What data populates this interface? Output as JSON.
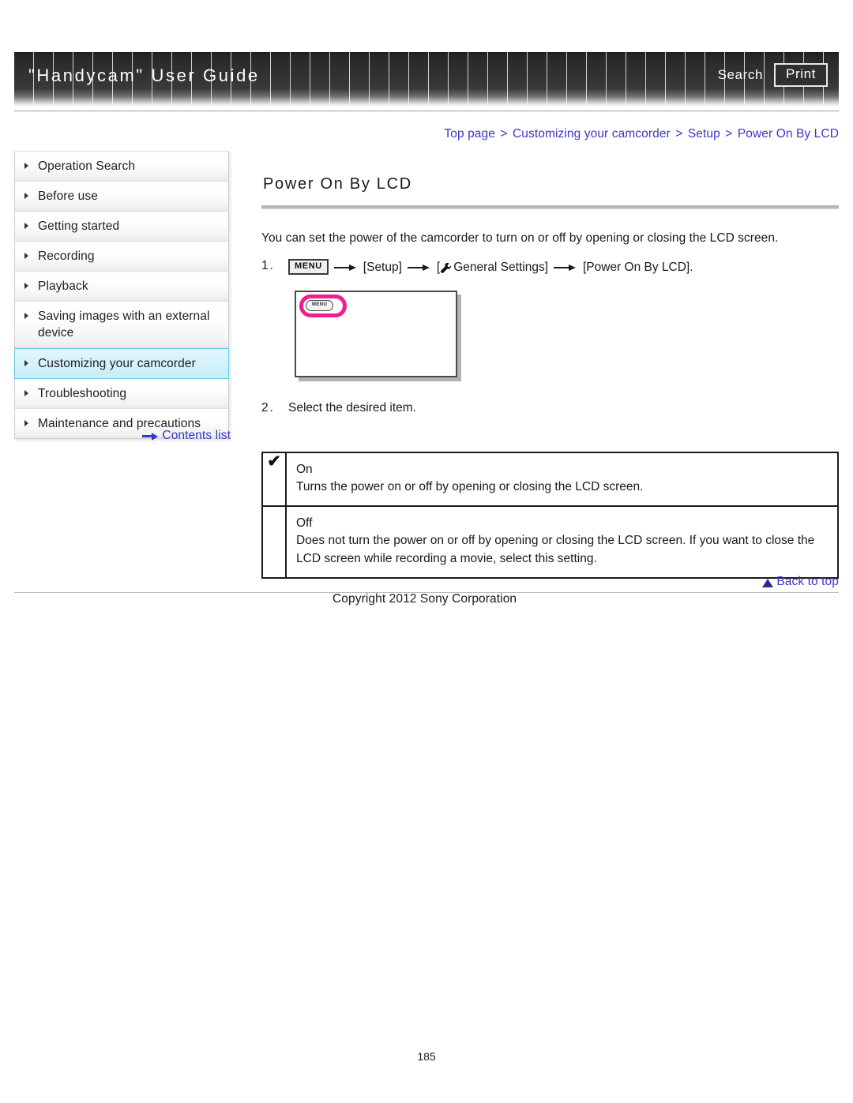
{
  "header": {
    "title": "\"Handycam\" User Guide",
    "search_label": "Search",
    "print_label": "Print"
  },
  "breadcrumb": {
    "items": [
      "Top page",
      "Customizing your camcorder",
      "Setup",
      "Power On By LCD"
    ],
    "separator": ">",
    "color": "#3b37c8"
  },
  "sidebar": {
    "items": [
      {
        "label": "Operation Search",
        "selected": false
      },
      {
        "label": "Before use",
        "selected": false
      },
      {
        "label": "Getting started",
        "selected": false
      },
      {
        "label": "Recording",
        "selected": false
      },
      {
        "label": "Playback",
        "selected": false
      },
      {
        "label": "Saving images with an external device",
        "selected": false
      },
      {
        "label": "Customizing your camcorder",
        "selected": true
      },
      {
        "label": "Troubleshooting",
        "selected": false
      },
      {
        "label": "Maintenance and precautions",
        "selected": false
      }
    ],
    "contents_list_label": "Contents list",
    "selected_border_color": "#66c8e2"
  },
  "main": {
    "title": "Power On By LCD",
    "intro": "You can set the power of the camcorder to turn on or off by opening or closing the LCD screen.",
    "step1": {
      "number": "1.",
      "menu_chip": "MENU",
      "part_setup": "[Setup]",
      "part_general_open": "[",
      "part_general": "General Settings]",
      "part_target": "[Power On By LCD]."
    },
    "screenshot": {
      "menu_chip": "MENU",
      "highlight_color": "#ee1f8e"
    },
    "step2": {
      "number": "2.",
      "text": "Select the desired item."
    },
    "options": [
      {
        "checked": true,
        "check_glyph": "✔",
        "name": "On",
        "description": "Turns the power on or off by opening or closing the LCD screen."
      },
      {
        "checked": false,
        "check_glyph": "",
        "name": "Off",
        "description": "Does not turn the power on or off by opening or closing the LCD screen. If you want to close the LCD screen while recording a movie, select this setting."
      }
    ]
  },
  "footer": {
    "back_to_top": "Back to top",
    "copyright": "Copyright 2012 Sony Corporation",
    "page_number": "185"
  }
}
